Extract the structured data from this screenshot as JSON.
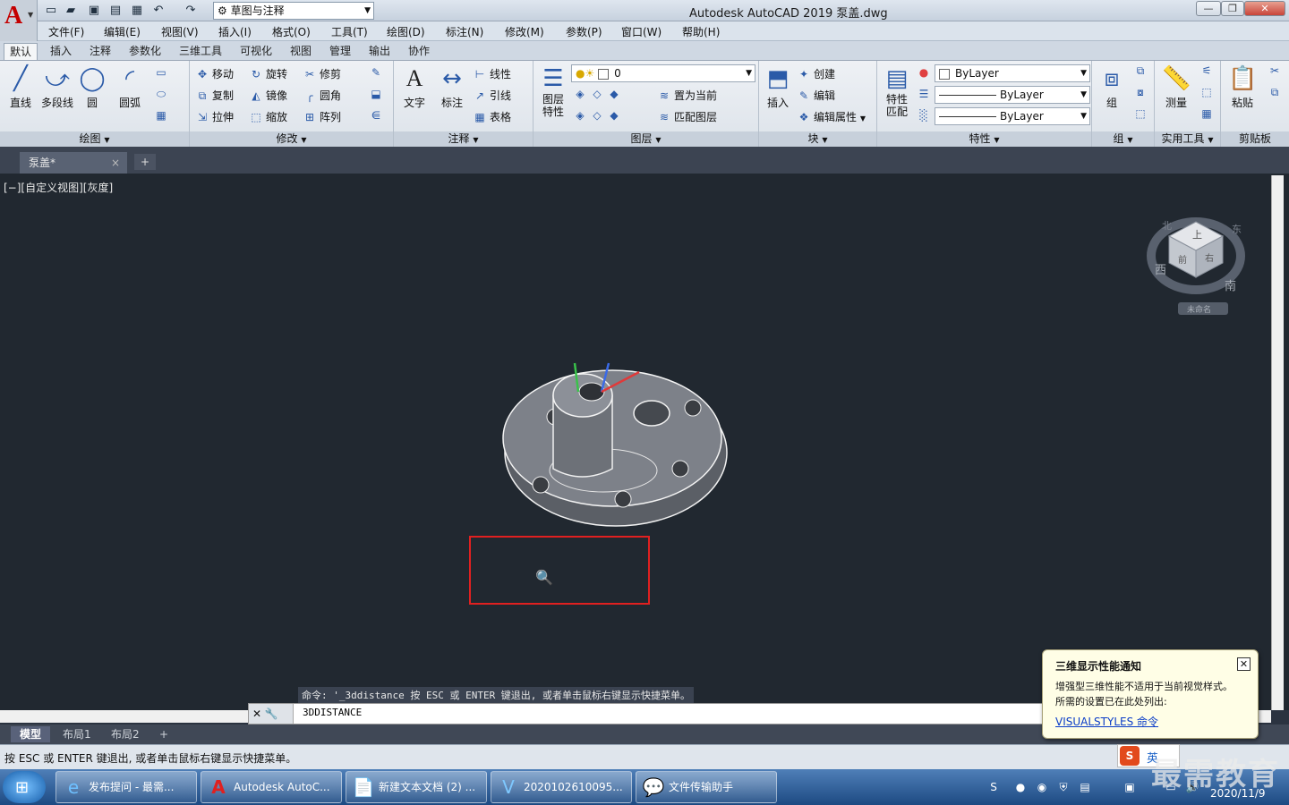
{
  "app": {
    "logo": "A",
    "title": "Autodesk AutoCAD 2019    泵盖.dwg",
    "workspace": "草图与注释"
  },
  "window_buttons": [
    "—",
    "❐",
    "✕"
  ],
  "menu": [
    "文件(F)",
    "编辑(E)",
    "视图(V)",
    "插入(I)",
    "格式(O)",
    "工具(T)",
    "绘图(D)",
    "标注(N)",
    "修改(M)",
    "参数(P)",
    "窗口(W)",
    "帮助(H)"
  ],
  "ribbon_tabs": [
    "默认",
    "插入",
    "注释",
    "参数化",
    "三维工具",
    "可视化",
    "视图",
    "管理",
    "输出",
    "协作"
  ],
  "ribbon": {
    "draw": {
      "title": "绘图",
      "line": "直线",
      "polyline": "多段线",
      "circle": "圆",
      "arc": "圆弧"
    },
    "modify": {
      "title": "修改",
      "move": "移动",
      "rotate": "旋转",
      "trim": "修剪",
      "copy": "复制",
      "mirror": "镜像",
      "fillet": "圆角",
      "stretch": "拉伸",
      "scale": "缩放",
      "array": "阵列"
    },
    "annotation": {
      "title": "注释",
      "text": "文字",
      "dimension": "标注",
      "linear": "线性",
      "leader": "引线",
      "table": "表格"
    },
    "layers": {
      "title": "图层",
      "props": "图层\n特性",
      "layer_value": "0",
      "make_current": "置为当前",
      "match": "匹配图层"
    },
    "block": {
      "title": "块",
      "insert": "插入",
      "create": "创建",
      "edit": "编辑",
      "edit_attr": "编辑属性"
    },
    "properties": {
      "title": "特性",
      "match": "特性\n匹配",
      "color": "ByLayer",
      "linetype": "ByLayer",
      "lineweight": "ByLayer"
    },
    "groups": {
      "title": "组",
      "group": "组"
    },
    "utilities": {
      "title": "实用工具",
      "measure": "测量"
    },
    "clipboard": {
      "title": "剪贴板",
      "paste": "粘贴"
    }
  },
  "doc_tab": {
    "name": "泵盖*",
    "close": "×",
    "add": "+"
  },
  "viewport": {
    "label": "[−][自定义视图][灰度]",
    "viewcube_top": "上",
    "viewcube_front": "前",
    "viewcube_right": "右",
    "compass_w": "西",
    "compass_s": "南",
    "compass_n": "北",
    "compass_e": "东",
    "ucs_name": "未命名"
  },
  "command": {
    "history": "命令: '_3ddistance 按 ESC 或 ENTER 键退出, 或者单击鼠标右键显示快捷菜单。",
    "input": "3DDISTANCE"
  },
  "layout_tabs": [
    "模型",
    "布局1",
    "布局2",
    "+"
  ],
  "status_text": "按 ESC 或 ENTER 键退出, 或者单击鼠标右键显示快捷菜单。",
  "notice": {
    "title": "三维显示性能通知",
    "body1": "增强型三维性能不适用于当前视觉样式。",
    "body2": "所需的设置已在此处列出:",
    "link": "VISUALSTYLES 命令",
    "close": "✕"
  },
  "taskbar": {
    "items": [
      "发布提问 - 最需...",
      "Autodesk AutoC...",
      "新建文本文档 (2) ...",
      "2020102610095...",
      "文件传输助手"
    ]
  },
  "clock": {
    "date": "2020/11/9"
  },
  "ime": {
    "label": "英"
  },
  "watermark": "最需教育",
  "colors": {
    "accent": "#2a5aa8",
    "redbox": "#e02020",
    "canvas": "#212830"
  }
}
